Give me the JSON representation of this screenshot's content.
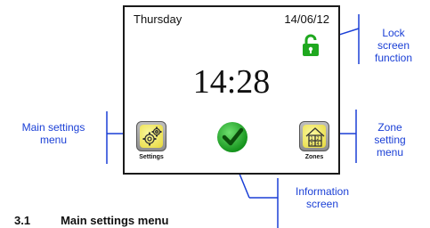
{
  "screen": {
    "day": "Thursday",
    "date": "14/06/12",
    "time": "14:28",
    "settings_label": "Settings",
    "zones_label": "Zones"
  },
  "callouts": {
    "lock": [
      "Lock",
      "screen",
      "function"
    ],
    "main_settings": [
      "Main settings",
      "menu"
    ],
    "zone": [
      "Zone",
      "setting",
      "menu"
    ],
    "information": [
      "Information",
      "screen"
    ]
  },
  "heading": {
    "number": "3.1",
    "title": "Main settings menu"
  },
  "colors": {
    "callout_blue": "#1a3fd6",
    "check_green": "#1fa81f",
    "tile_yellow": "#eee45a"
  },
  "icons": [
    "lock-icon",
    "gears-icon",
    "checkmark-icon",
    "house-zones-icon"
  ]
}
